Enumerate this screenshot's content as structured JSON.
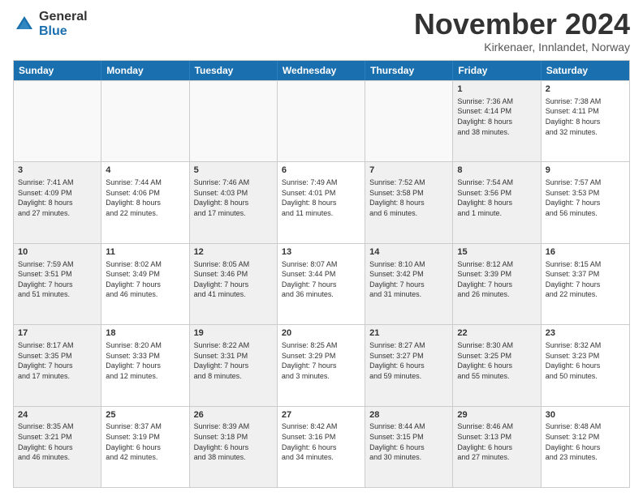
{
  "logo": {
    "general": "General",
    "blue": "Blue"
  },
  "title": "November 2024",
  "location": "Kirkenaer, Innlandet, Norway",
  "header_days": [
    "Sunday",
    "Monday",
    "Tuesday",
    "Wednesday",
    "Thursday",
    "Friday",
    "Saturday"
  ],
  "rows": [
    [
      {
        "day": "",
        "text": "",
        "empty": true
      },
      {
        "day": "",
        "text": "",
        "empty": true
      },
      {
        "day": "",
        "text": "",
        "empty": true
      },
      {
        "day": "",
        "text": "",
        "empty": true
      },
      {
        "day": "",
        "text": "",
        "empty": true
      },
      {
        "day": "1",
        "text": "Sunrise: 7:36 AM\nSunset: 4:14 PM\nDaylight: 8 hours\nand 38 minutes.",
        "shaded": true
      },
      {
        "day": "2",
        "text": "Sunrise: 7:38 AM\nSunset: 4:11 PM\nDaylight: 8 hours\nand 32 minutes.",
        "shaded": false
      }
    ],
    [
      {
        "day": "3",
        "text": "Sunrise: 7:41 AM\nSunset: 4:09 PM\nDaylight: 8 hours\nand 27 minutes.",
        "shaded": true
      },
      {
        "day": "4",
        "text": "Sunrise: 7:44 AM\nSunset: 4:06 PM\nDaylight: 8 hours\nand 22 minutes.",
        "shaded": false
      },
      {
        "day": "5",
        "text": "Sunrise: 7:46 AM\nSunset: 4:03 PM\nDaylight: 8 hours\nand 17 minutes.",
        "shaded": true
      },
      {
        "day": "6",
        "text": "Sunrise: 7:49 AM\nSunset: 4:01 PM\nDaylight: 8 hours\nand 11 minutes.",
        "shaded": false
      },
      {
        "day": "7",
        "text": "Sunrise: 7:52 AM\nSunset: 3:58 PM\nDaylight: 8 hours\nand 6 minutes.",
        "shaded": true
      },
      {
        "day": "8",
        "text": "Sunrise: 7:54 AM\nSunset: 3:56 PM\nDaylight: 8 hours\nand 1 minute.",
        "shaded": true
      },
      {
        "day": "9",
        "text": "Sunrise: 7:57 AM\nSunset: 3:53 PM\nDaylight: 7 hours\nand 56 minutes.",
        "shaded": false
      }
    ],
    [
      {
        "day": "10",
        "text": "Sunrise: 7:59 AM\nSunset: 3:51 PM\nDaylight: 7 hours\nand 51 minutes.",
        "shaded": true
      },
      {
        "day": "11",
        "text": "Sunrise: 8:02 AM\nSunset: 3:49 PM\nDaylight: 7 hours\nand 46 minutes.",
        "shaded": false
      },
      {
        "day": "12",
        "text": "Sunrise: 8:05 AM\nSunset: 3:46 PM\nDaylight: 7 hours\nand 41 minutes.",
        "shaded": true
      },
      {
        "day": "13",
        "text": "Sunrise: 8:07 AM\nSunset: 3:44 PM\nDaylight: 7 hours\nand 36 minutes.",
        "shaded": false
      },
      {
        "day": "14",
        "text": "Sunrise: 8:10 AM\nSunset: 3:42 PM\nDaylight: 7 hours\nand 31 minutes.",
        "shaded": true
      },
      {
        "day": "15",
        "text": "Sunrise: 8:12 AM\nSunset: 3:39 PM\nDaylight: 7 hours\nand 26 minutes.",
        "shaded": true
      },
      {
        "day": "16",
        "text": "Sunrise: 8:15 AM\nSunset: 3:37 PM\nDaylight: 7 hours\nand 22 minutes.",
        "shaded": false
      }
    ],
    [
      {
        "day": "17",
        "text": "Sunrise: 8:17 AM\nSunset: 3:35 PM\nDaylight: 7 hours\nand 17 minutes.",
        "shaded": true
      },
      {
        "day": "18",
        "text": "Sunrise: 8:20 AM\nSunset: 3:33 PM\nDaylight: 7 hours\nand 12 minutes.",
        "shaded": false
      },
      {
        "day": "19",
        "text": "Sunrise: 8:22 AM\nSunset: 3:31 PM\nDaylight: 7 hours\nand 8 minutes.",
        "shaded": true
      },
      {
        "day": "20",
        "text": "Sunrise: 8:25 AM\nSunset: 3:29 PM\nDaylight: 7 hours\nand 3 minutes.",
        "shaded": false
      },
      {
        "day": "21",
        "text": "Sunrise: 8:27 AM\nSunset: 3:27 PM\nDaylight: 6 hours\nand 59 minutes.",
        "shaded": true
      },
      {
        "day": "22",
        "text": "Sunrise: 8:30 AM\nSunset: 3:25 PM\nDaylight: 6 hours\nand 55 minutes.",
        "shaded": true
      },
      {
        "day": "23",
        "text": "Sunrise: 8:32 AM\nSunset: 3:23 PM\nDaylight: 6 hours\nand 50 minutes.",
        "shaded": false
      }
    ],
    [
      {
        "day": "24",
        "text": "Sunrise: 8:35 AM\nSunset: 3:21 PM\nDaylight: 6 hours\nand 46 minutes.",
        "shaded": true
      },
      {
        "day": "25",
        "text": "Sunrise: 8:37 AM\nSunset: 3:19 PM\nDaylight: 6 hours\nand 42 minutes.",
        "shaded": false
      },
      {
        "day": "26",
        "text": "Sunrise: 8:39 AM\nSunset: 3:18 PM\nDaylight: 6 hours\nand 38 minutes.",
        "shaded": true
      },
      {
        "day": "27",
        "text": "Sunrise: 8:42 AM\nSunset: 3:16 PM\nDaylight: 6 hours\nand 34 minutes.",
        "shaded": false
      },
      {
        "day": "28",
        "text": "Sunrise: 8:44 AM\nSunset: 3:15 PM\nDaylight: 6 hours\nand 30 minutes.",
        "shaded": true
      },
      {
        "day": "29",
        "text": "Sunrise: 8:46 AM\nSunset: 3:13 PM\nDaylight: 6 hours\nand 27 minutes.",
        "shaded": true
      },
      {
        "day": "30",
        "text": "Sunrise: 8:48 AM\nSunset: 3:12 PM\nDaylight: 6 hours\nand 23 minutes.",
        "shaded": false
      }
    ]
  ]
}
